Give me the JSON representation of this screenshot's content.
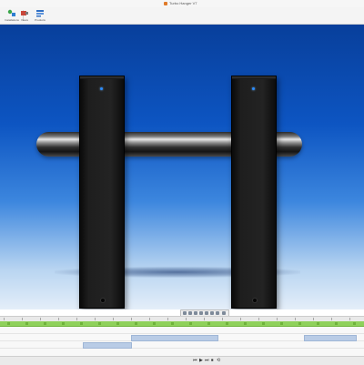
{
  "window": {
    "title": "Turbo Hanger V7"
  },
  "toolbar": {
    "items": [
      {
        "label": "Installations",
        "icon": "assembly-icon"
      },
      {
        "label": "Views",
        "icon": "camera-views-icon"
      },
      {
        "label": "Products",
        "icon": "products-icon"
      }
    ]
  },
  "colors": {
    "viewport_top": "#083f9b",
    "viewport_bottom": "#e4eef9",
    "timeline_bar": "#8fd15b",
    "clip": "#b9cce6",
    "led": "#2a8cff"
  },
  "viewtools": {
    "icons": [
      "select-icon",
      "pan-icon",
      "zoom-icon",
      "rotate-icon",
      "fit-icon",
      "section-icon",
      "render-icon",
      "settings-icon"
    ]
  },
  "timeline": {
    "ticks": [
      "",
      "",
      "",
      "",
      "",
      "",
      "",
      "",
      "",
      "",
      "",
      "",
      "",
      ""
    ],
    "tracks": [
      {
        "clips": []
      },
      {
        "clips": [
          {
            "label": ""
          },
          {
            "label": ""
          },
          {
            "label": ""
          }
        ]
      },
      {
        "clips": [
          {
            "label": ""
          }
        ]
      }
    ]
  },
  "playback": {
    "buttons": [
      "⏮",
      "▶",
      "⏭",
      "⏹",
      "⟲"
    ]
  }
}
